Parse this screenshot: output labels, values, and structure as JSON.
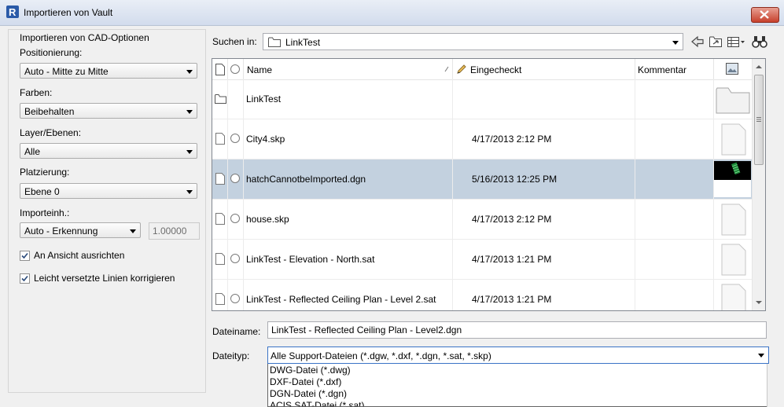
{
  "window": {
    "title": "Importieren von Vault"
  },
  "options": {
    "group_title": "Importieren von CAD-Optionen",
    "positioning_label": "Positionierung:",
    "positioning_value": "Auto - Mitte zu Mitte",
    "colors_label": "Farben:",
    "colors_value": "Beibehalten",
    "layers_label": "Layer/Ebenen:",
    "layers_value": "Alle",
    "placement_label": "Platzierung:",
    "placement_value": "Ebene 0",
    "units_label": "Importeinh.:",
    "units_value": "Auto - Erkennung",
    "units_factor": "1.00000",
    "orient_label": "An Ansicht ausrichten",
    "orient_checked": true,
    "fix_lines_label": "Leicht versetzte Linien korrigieren",
    "fix_lines_checked": true
  },
  "search": {
    "label": "Suchen in:",
    "value": "LinkTest"
  },
  "toolbar": {
    "icons": [
      "back-icon",
      "up-folder-icon",
      "view-menu-icon",
      "find-icon"
    ]
  },
  "file_list": {
    "columns": {
      "name": "Name",
      "checked_in": "Eingecheckt",
      "comment": "Kommentar"
    },
    "rows": [
      {
        "name": "LinkTest",
        "checked_in": "",
        "comment": "",
        "type": "folder",
        "selected": false
      },
      {
        "name": "City4.skp",
        "checked_in": "4/17/2013 2:12 PM",
        "comment": "",
        "type": "file",
        "selected": false
      },
      {
        "name": "hatchCannotbeImported.dgn",
        "checked_in": "5/16/2013 12:25 PM",
        "comment": "",
        "type": "file",
        "selected": true
      },
      {
        "name": "house.skp",
        "checked_in": "4/17/2013 2:12 PM",
        "comment": "",
        "type": "file",
        "selected": false
      },
      {
        "name": "LinkTest - Elevation - North.sat",
        "checked_in": "4/17/2013 1:21 PM",
        "comment": "",
        "type": "file",
        "selected": false
      },
      {
        "name": "LinkTest - Reflected Ceiling Plan - Level 2.sat",
        "checked_in": "4/17/2013 1:21 PM",
        "comment": "",
        "type": "file",
        "selected": false
      }
    ]
  },
  "filename": {
    "label": "Dateiname:",
    "value": "LinkTest - Reflected Ceiling Plan - Level2.dgn"
  },
  "filetype": {
    "label": "Dateityp:",
    "value": "Alle Support-Dateien (*.dgw, *.dxf, *.dgn, *.sat, *.skp)",
    "options": [
      "DWG-Datei (*.dwg)",
      "DXF-Datei (*.dxf)",
      "DGN-Datei (*.dgn)",
      "ACIS SAT-Datei (*.sat)"
    ]
  },
  "colors": {
    "selection": "#c3d1df",
    "close": "#c7402c",
    "focus_border": "#3a73c6"
  }
}
